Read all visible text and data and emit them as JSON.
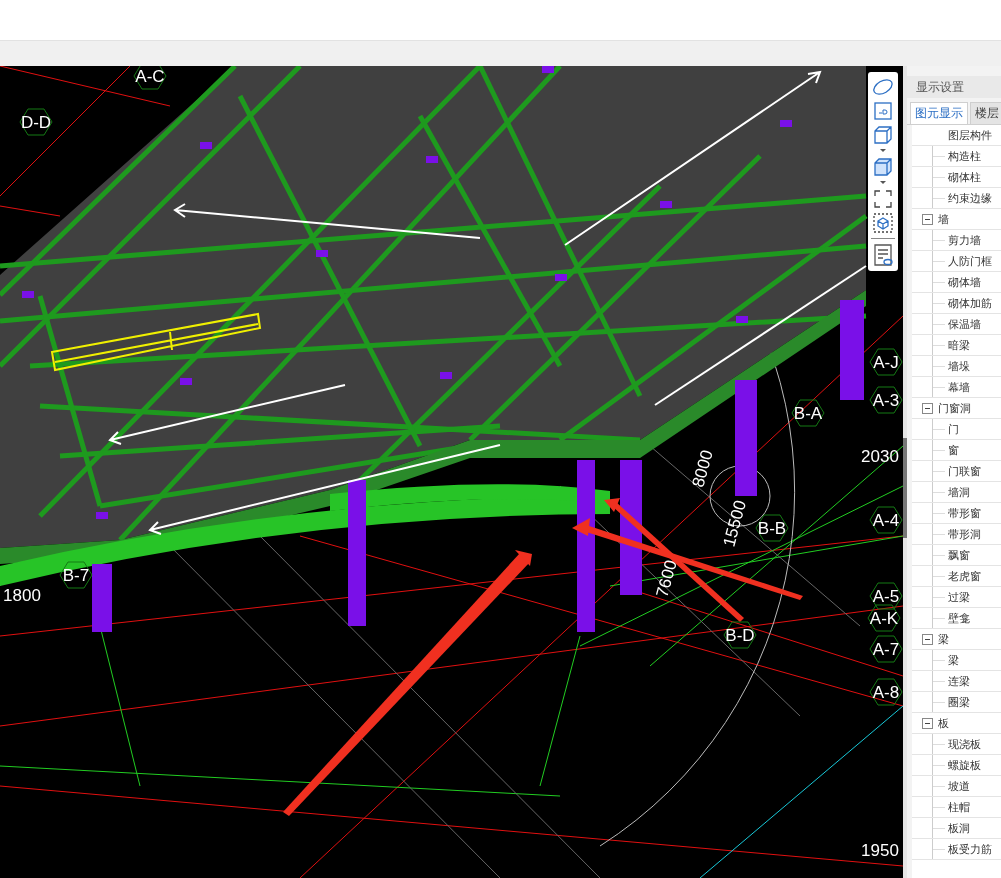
{
  "viewport": {
    "axis_labels": [
      "A-C",
      "D-D",
      "A-J",
      "A-3",
      "B-A",
      "A-4",
      "B-B",
      "B-D",
      "A-5",
      "A-K",
      "A-7",
      "A-8",
      "B-7"
    ],
    "dimension_labels": [
      "2030",
      "8000",
      "15500",
      "7600",
      "1800",
      "1950"
    ]
  },
  "panel": {
    "title": "显示设置",
    "tabs": [
      {
        "label": "图元显示",
        "selected": true
      },
      {
        "label": "楼层",
        "selected": false
      }
    ],
    "tree_header": "图层构件",
    "tree": [
      {
        "label": "构造柱"
      },
      {
        "label": "砌体柱"
      },
      {
        "label": "约束边缘"
      },
      {
        "label": "墙",
        "expanded": true,
        "children": [
          {
            "label": "剪力墙"
          },
          {
            "label": "人防门框"
          },
          {
            "label": "砌体墙"
          },
          {
            "label": "砌体加筋"
          },
          {
            "label": "保温墙"
          },
          {
            "label": "暗梁"
          },
          {
            "label": "墙垛"
          },
          {
            "label": "幕墙"
          }
        ]
      },
      {
        "label": "门窗洞",
        "expanded": true,
        "children": [
          {
            "label": "门"
          },
          {
            "label": "窗"
          },
          {
            "label": "门联窗"
          },
          {
            "label": "墙洞"
          },
          {
            "label": "带形窗"
          },
          {
            "label": "带形洞"
          },
          {
            "label": "飘窗"
          },
          {
            "label": "老虎窗"
          },
          {
            "label": "过梁"
          },
          {
            "label": "壁龛"
          }
        ]
      },
      {
        "label": "梁",
        "expanded": true,
        "children": [
          {
            "label": "梁"
          },
          {
            "label": "连梁"
          },
          {
            "label": "圈梁"
          }
        ]
      },
      {
        "label": "板",
        "expanded": true,
        "children": [
          {
            "label": "现浇板"
          },
          {
            "label": "螺旋板"
          },
          {
            "label": "坡道"
          },
          {
            "label": "柱帽"
          },
          {
            "label": "板洞"
          },
          {
            "label": "板受力筋"
          }
        ]
      }
    ]
  }
}
